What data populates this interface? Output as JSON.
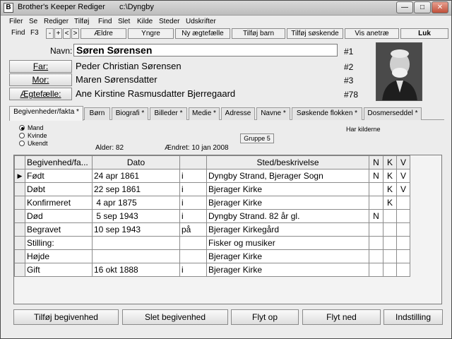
{
  "window": {
    "title": "Brother's Keeper Rediger",
    "path": "c:\\Dyngby",
    "min": "—",
    "max": "□",
    "close": "✕"
  },
  "menu": [
    "Filer",
    "Se",
    "Rediger",
    "Tilføj",
    "Find",
    "Slet",
    "Kilde",
    "Steder",
    "Udskrifter"
  ],
  "toolbar": {
    "find": "Find",
    "f3": "F3",
    "minus": "-",
    "plus": "+",
    "prev": "<",
    "next": ">",
    "aeldre": "Ældre",
    "yngre": "Yngre",
    "ny_aegtefaelle": "Ny ægtefælle",
    "tilfoj_barn": "Tilføj barn",
    "tilfoj_soskende": "Tilføj søskende",
    "vis_anetrae": "Vis anetræ",
    "luk": "Luk"
  },
  "person": {
    "navn_label": "Navn:",
    "navn": "Søren Sørensen",
    "navn_ref": "#1",
    "far_label": "Far:",
    "far": "Peder Christian Sørensen",
    "far_ref": "#2",
    "mor_label": "Mor:",
    "mor": "Maren Sørensdatter",
    "mor_ref": "#3",
    "aegtefaelle_label": "Ægtefælle:",
    "aegtefaelle": "Ane Kirstine Rasmusdatter Bjerregaard",
    "aegtefaelle_ref": "#78"
  },
  "tabs": [
    "Begivenheder/fakta *",
    "Børn",
    "Biografi *",
    "Billeder *",
    "Medie *",
    "Adresse",
    "Navne *",
    "Søskende flokken *",
    "Dosmerseddel *"
  ],
  "gender": {
    "mand": "Mand",
    "kvinde": "Kvinde",
    "ukendt": "Ukendt",
    "selected": "Mand"
  },
  "info": {
    "alder": "Alder: 82",
    "aendret": "Ændret: 10 jan 2008",
    "gruppe": "Gruppe 5",
    "har_kilderne": "Har kilderne"
  },
  "grid": {
    "headers": [
      "Begivenhed/fa...",
      "Dato",
      "",
      "Sted/beskrivelse",
      "N",
      "K",
      "V"
    ],
    "rows": [
      {
        "ind": "▶",
        "event": "Født",
        "date": "24 apr 1861",
        "prep": "i",
        "place": "Dyngby Strand, Bjerager Sogn",
        "n": "N",
        "k": "K",
        "v": "V"
      },
      {
        "ind": "",
        "event": "Døbt",
        "date": "22 sep 1861",
        "prep": "i",
        "place": "Bjerager Kirke",
        "n": "",
        "k": "K",
        "v": "V"
      },
      {
        "ind": "",
        "event": "Konfirmeret",
        "date": " 4 apr 1875",
        "prep": "i",
        "place": "Bjerager Kirke",
        "n": "",
        "k": "K",
        "v": ""
      },
      {
        "ind": "",
        "event": "Død",
        "date": " 5 sep 1943",
        "prep": "i",
        "place": "Dyngby Strand. 82 år gl.",
        "n": "N",
        "k": "",
        "v": ""
      },
      {
        "ind": "",
        "event": "Begravet",
        "date": "10 sep 1943",
        "prep": "på",
        "place": "Bjerager Kirkegård",
        "n": "",
        "k": "",
        "v": ""
      },
      {
        "ind": "",
        "event": "Stilling:",
        "date": "",
        "prep": "",
        "place": "Fisker og musiker",
        "n": "",
        "k": "",
        "v": ""
      },
      {
        "ind": "",
        "event": "Højde",
        "date": "",
        "prep": "",
        "place": "Bjerager Kirke",
        "n": "",
        "k": "",
        "v": ""
      },
      {
        "ind": "",
        "event": "Gift",
        "date": "16 okt 1888",
        "prep": "i",
        "place": "Bjerager Kirke",
        "n": "",
        "k": "",
        "v": ""
      }
    ]
  },
  "buttons": {
    "tilfoj": "Tilføj begivenhed",
    "slet": "Slet begivenhed",
    "flyt_op": "Flyt op",
    "flyt_ned": "Flyt ned",
    "indstilling": "Indstilling"
  }
}
